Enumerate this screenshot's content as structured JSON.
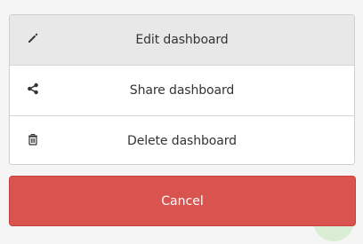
{
  "menu": {
    "items": [
      {
        "label": "Edit dashboard",
        "icon": "pencil-icon",
        "active": true
      },
      {
        "label": "Share dashboard",
        "icon": "share-icon",
        "active": false
      },
      {
        "label": "Delete dashboard",
        "icon": "trash-icon",
        "active": false
      }
    ]
  },
  "cancel": {
    "label": "Cancel",
    "color": "#d9534f"
  },
  "colors": {
    "active_item_bg": "#e8e8e8",
    "text": "#333333"
  }
}
